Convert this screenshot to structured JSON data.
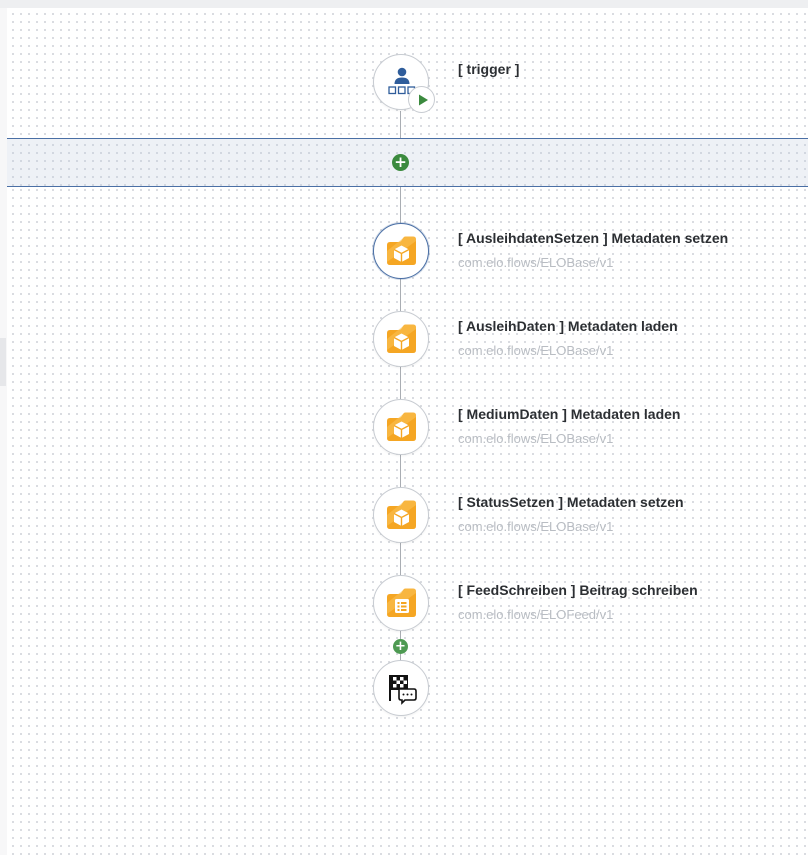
{
  "flow": {
    "trigger": {
      "label": "[ trigger ]",
      "icon": "user-trigger-icon"
    },
    "add_label": "+",
    "steps": [
      {
        "id": "AusleihdatenSetzen",
        "label": "[ AusleihdatenSetzen ] Metadaten setzen",
        "service": "com.elo.flows/ELOBase/v1",
        "icon": "elo-base-cube-icon",
        "selected": true
      },
      {
        "id": "AusleihDaten",
        "label": "[ AusleihDaten ] Metadaten laden",
        "service": "com.elo.flows/ELOBase/v1",
        "icon": "elo-base-cube-icon",
        "selected": false
      },
      {
        "id": "MediumDaten",
        "label": "[ MediumDaten ] Metadaten laden",
        "service": "com.elo.flows/ELOBase/v1",
        "icon": "elo-base-cube-icon",
        "selected": false
      },
      {
        "id": "StatusSetzen",
        "label": "[ StatusSetzen ] Metadaten setzen",
        "service": "com.elo.flows/ELOBase/v1",
        "icon": "elo-base-cube-icon",
        "selected": false
      },
      {
        "id": "FeedSchreiben",
        "label": "[ FeedSchreiben ] Beitrag schreiben",
        "service": "com.elo.flows/ELOFeed/v1",
        "icon": "elo-feed-post-icon",
        "selected": false
      }
    ],
    "end": {
      "icon": "finish-flag-feedback-icon"
    }
  },
  "colors": {
    "accent_orange": "#f5a623",
    "accent_orange_dark": "#e08e0b",
    "add_green": "#3b8a3e",
    "selection_blue": "#4a6fa5",
    "trigger_blue": "#2f5d9b"
  }
}
